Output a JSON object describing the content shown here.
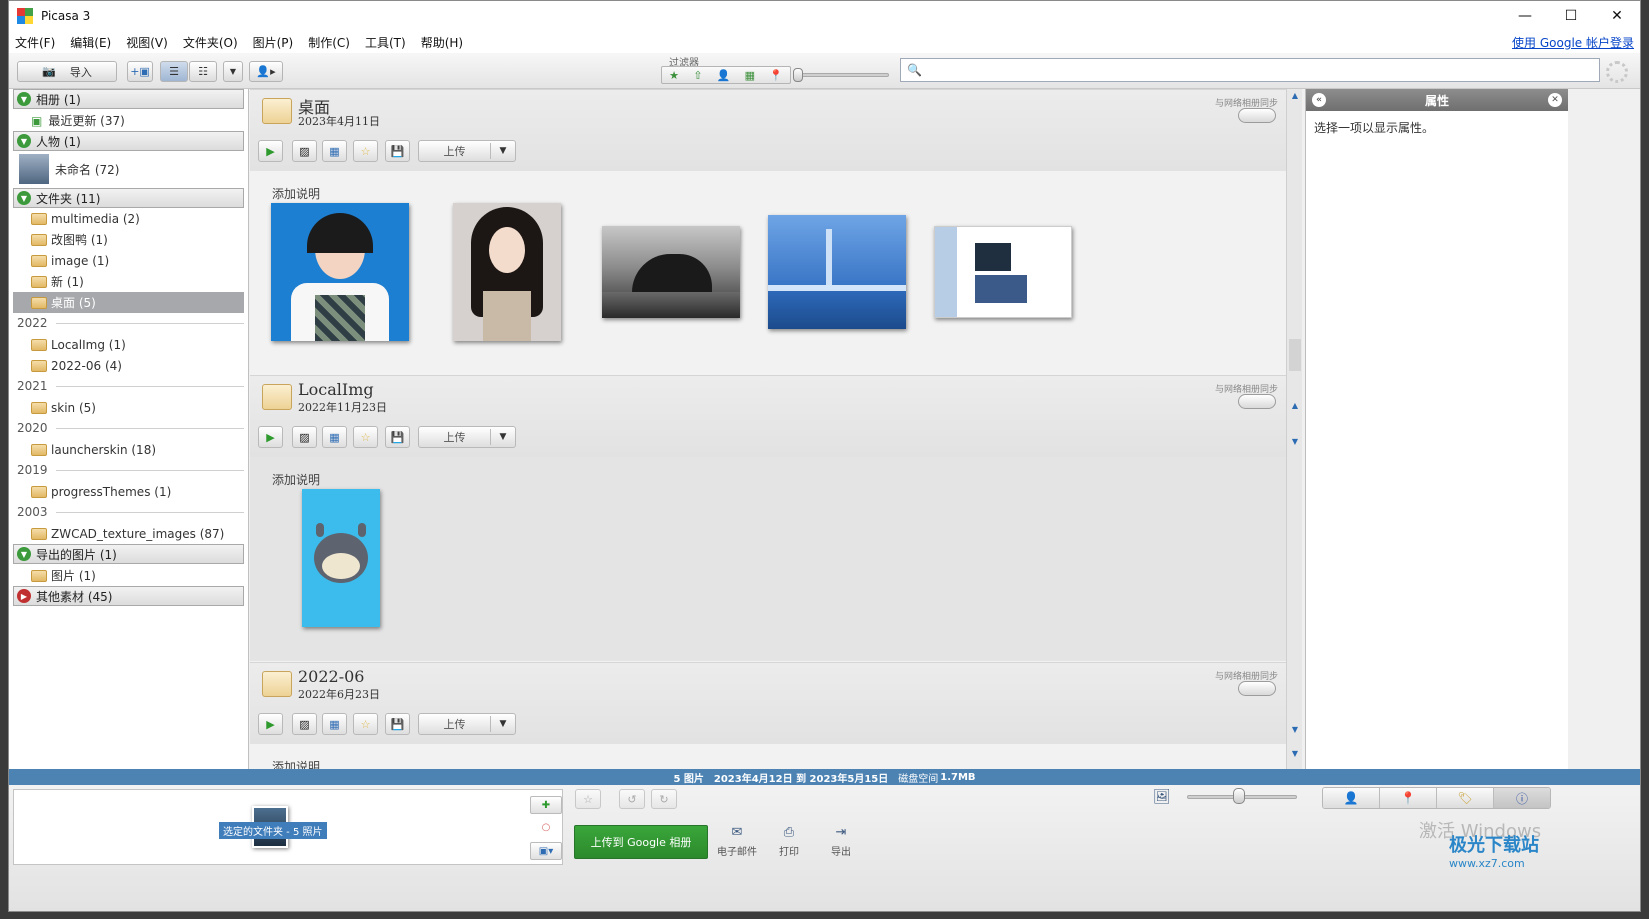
{
  "window": {
    "title": "Picasa 3",
    "controls": [
      "—",
      "☐",
      "✕"
    ]
  },
  "menu": {
    "items": [
      "文件(F)",
      "编辑(E)",
      "视图(V)",
      "文件夹(O)",
      "图片(P)",
      "制作(C)",
      "工具(T)",
      "帮助(H)"
    ],
    "google_login": "使用 Google 帐户登录"
  },
  "toolbar": {
    "import_label": "导入",
    "filter_label": "过滤器",
    "search_placeholder": ""
  },
  "sidebar": {
    "categories": [
      {
        "label": "相册 (1)",
        "state": "open"
      },
      {
        "label": "人物 (1)",
        "state": "open"
      },
      {
        "label": "文件夹 (11)",
        "state": "open"
      },
      {
        "label": "导出的图片 (1)",
        "state": "open"
      },
      {
        "label": "其他素材 (45)",
        "state": "closed"
      }
    ],
    "recent": "最近更新 (37)",
    "person": "未命名 (72)",
    "folders_top": [
      "multimedia (2)",
      "改图鸭 (1)",
      "image (1)",
      "新 (1)",
      "桌面 (5)"
    ],
    "years": [
      "2022",
      "2021",
      "2020",
      "2019",
      "2003"
    ],
    "folders_2022": [
      "LocalImg (1)",
      "2022-06 (4)"
    ],
    "folders_2021": [
      "skin (5)"
    ],
    "folders_2020": [
      "launcherskin (18)"
    ],
    "folders_2019": [
      "progressThemes (1)"
    ],
    "folders_2003": [
      "ZWCAD_texture_images (87)"
    ],
    "exported": [
      "图片 (1)"
    ]
  },
  "albums": [
    {
      "title": "桌面",
      "date": "2023年4月11日",
      "sync": "与网络相册同步",
      "upload": "上传",
      "caption": "添加说明"
    },
    {
      "title": "LocalImg",
      "date": "2022年11月23日",
      "sync": "与网络相册同步",
      "upload": "上传",
      "caption": "添加说明"
    },
    {
      "title": "2022-06",
      "date": "2022年6月23日",
      "sync": "与网络相册同步",
      "upload": "上传",
      "caption": "添加说明"
    }
  ],
  "properties": {
    "title": "属性",
    "hint": "选择一项以显示属性。"
  },
  "status": {
    "count": "5 图片",
    "range": "2023年4月12日 到 2023年5月15日",
    "disk_label": "磁盘空间",
    "disk_value": "1.7MB"
  },
  "tray": {
    "label": "选定的文件夹 - 5 照片",
    "google_upload": "上传到 Google 相册",
    "email": "电子邮件",
    "print": "打印",
    "export": "导出"
  },
  "watermark": {
    "windows": "激活 Windows",
    "brand": "极光下载站",
    "url": "www.xz7.com"
  },
  "colors": {
    "status_bar": "#4c83b3",
    "google_button": "#3aa63a",
    "selected_folder": "#a6a8ab"
  }
}
